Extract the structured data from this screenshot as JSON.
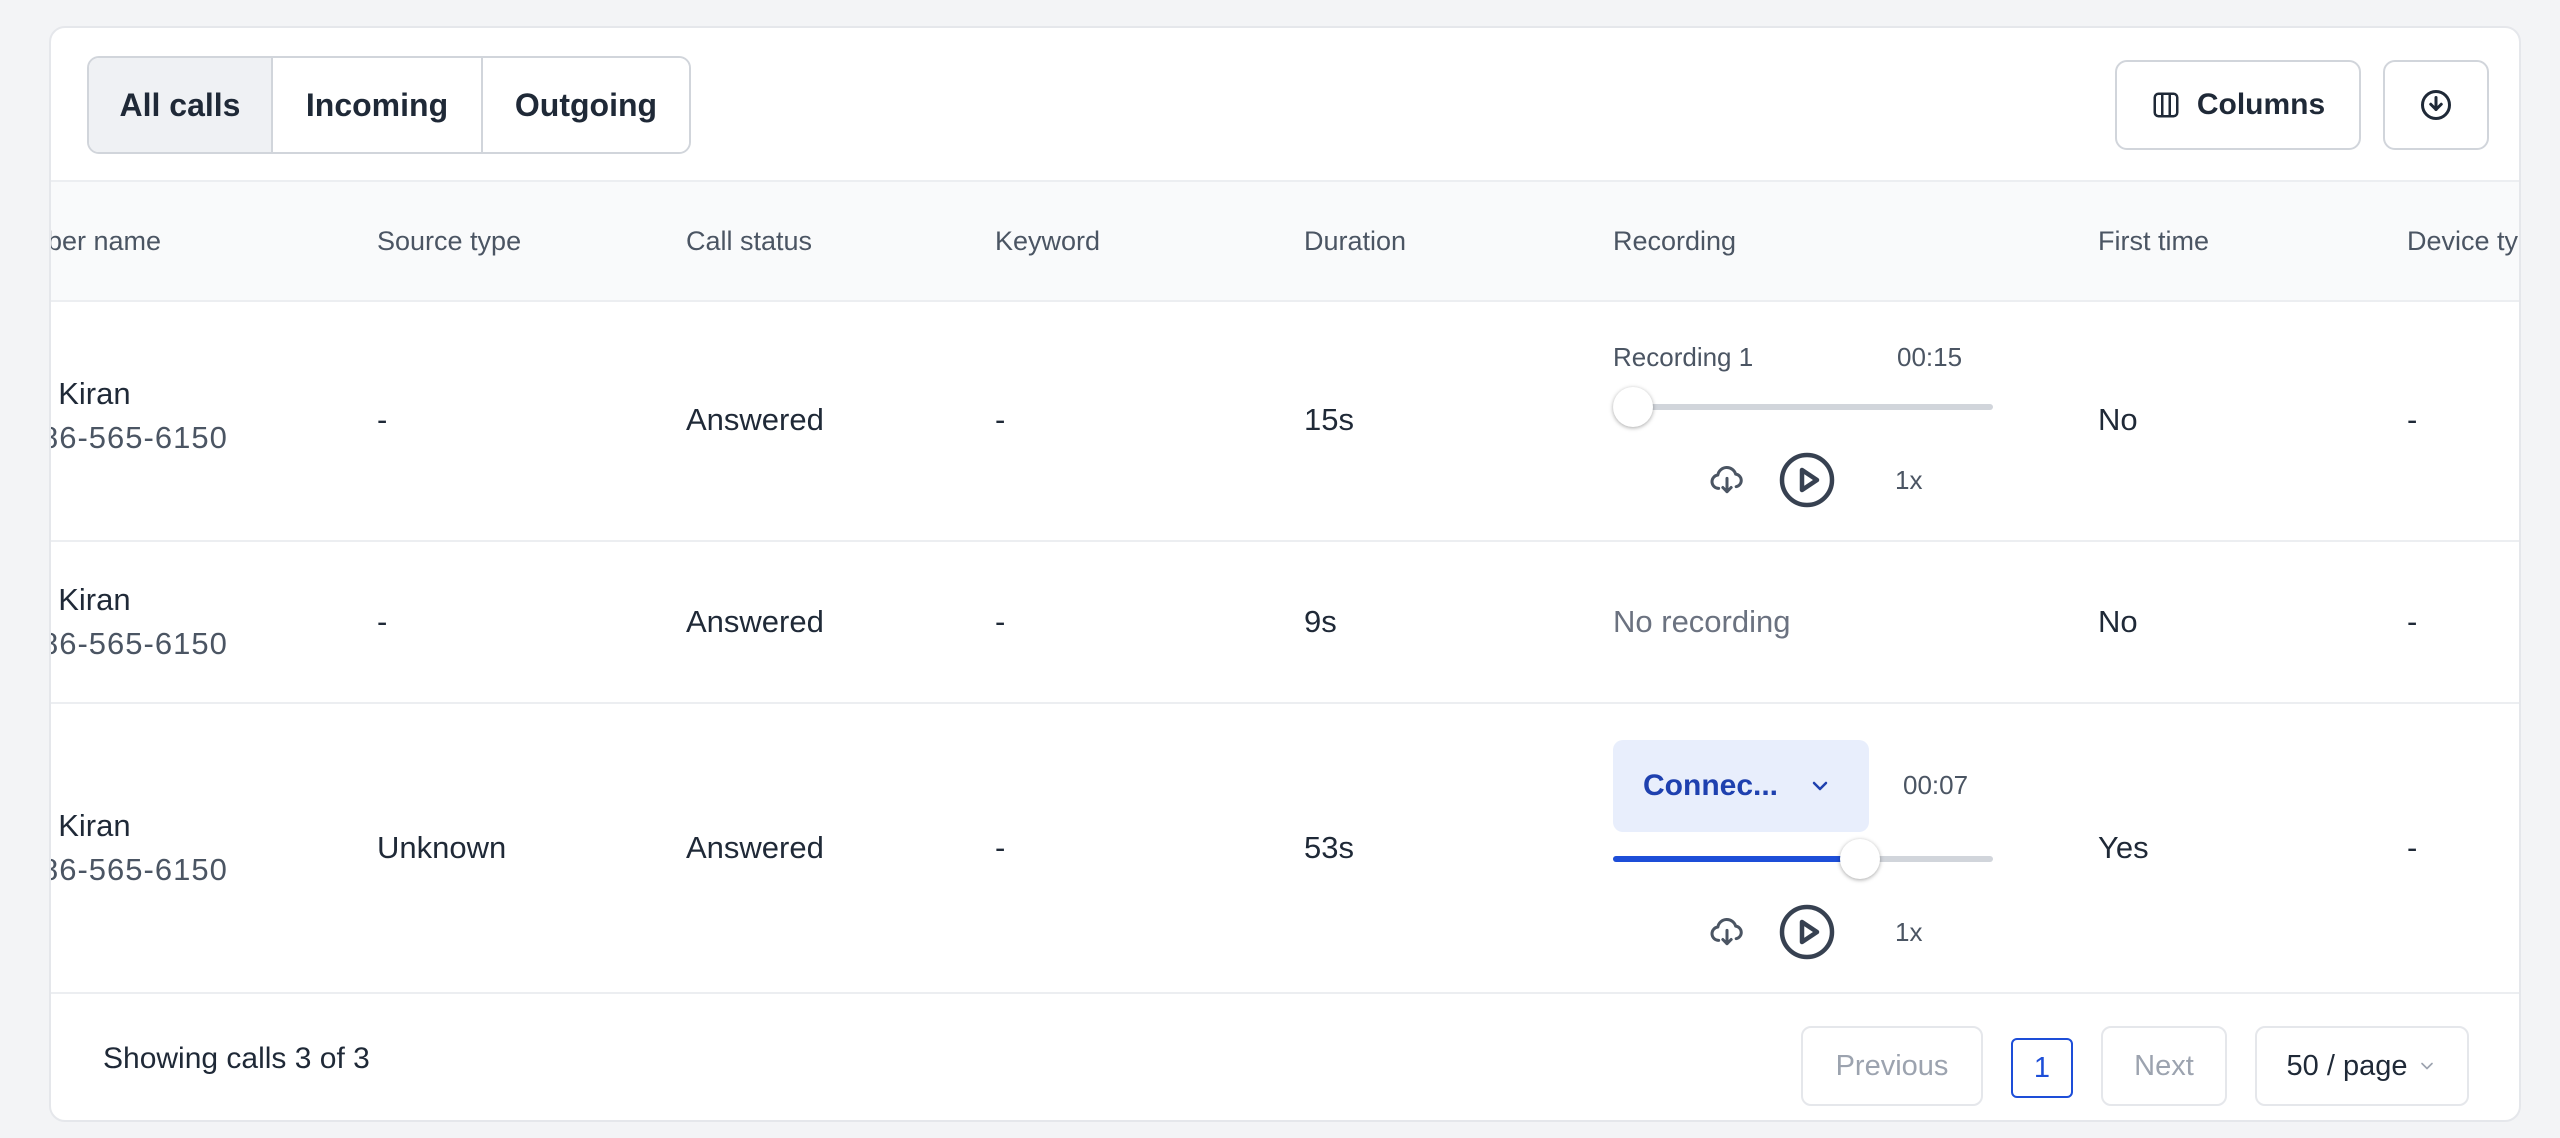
{
  "tabs": [
    {
      "label": "All calls",
      "active": true
    },
    {
      "label": "Incoming",
      "active": false
    },
    {
      "label": "Outgoing",
      "active": false
    }
  ],
  "toolbar": {
    "columns_label": "Columns",
    "columns_icon": "columns-icon",
    "download_icon": "download-icon"
  },
  "table": {
    "columns": [
      "ber name",
      "Source type",
      "Call status",
      "Keyword",
      "Duration",
      "Recording",
      "First time",
      "Device ty"
    ],
    "rows": [
      {
        "name": ": Kiran",
        "phone": "86-565-6150",
        "source_type": "-",
        "call_status": "Answered",
        "keyword": "-",
        "duration": "15s",
        "recording": {
          "label": "Recording 1",
          "time": "00:15",
          "progress": 0.0,
          "speed": "1x"
        },
        "first_time": "No",
        "device_type": "-"
      },
      {
        "name": ": Kiran",
        "phone": "86-565-6150",
        "source_type": "-",
        "call_status": "Answered",
        "keyword": "-",
        "duration": "9s",
        "recording_text": "No recording",
        "first_time": "No",
        "device_type": "-"
      },
      {
        "name": ": Kiran",
        "phone": "86-565-6150",
        "source_type": "Unknown",
        "call_status": "Answered",
        "keyword": "-",
        "duration": "53s",
        "recording": {
          "dropdown_label": "Connec...",
          "time": "00:07",
          "progress": 0.65,
          "speed": "1x"
        },
        "first_time": "Yes",
        "device_type": "-"
      }
    ]
  },
  "footer": {
    "showing": "Showing calls 3 of 3",
    "previous": "Previous",
    "page": "1",
    "next": "Next",
    "page_size": "50 / page"
  },
  "colors": {
    "accent": "#1d4ed8",
    "dropdown_bg": "#e8eefc",
    "border": "#d1d5db"
  }
}
